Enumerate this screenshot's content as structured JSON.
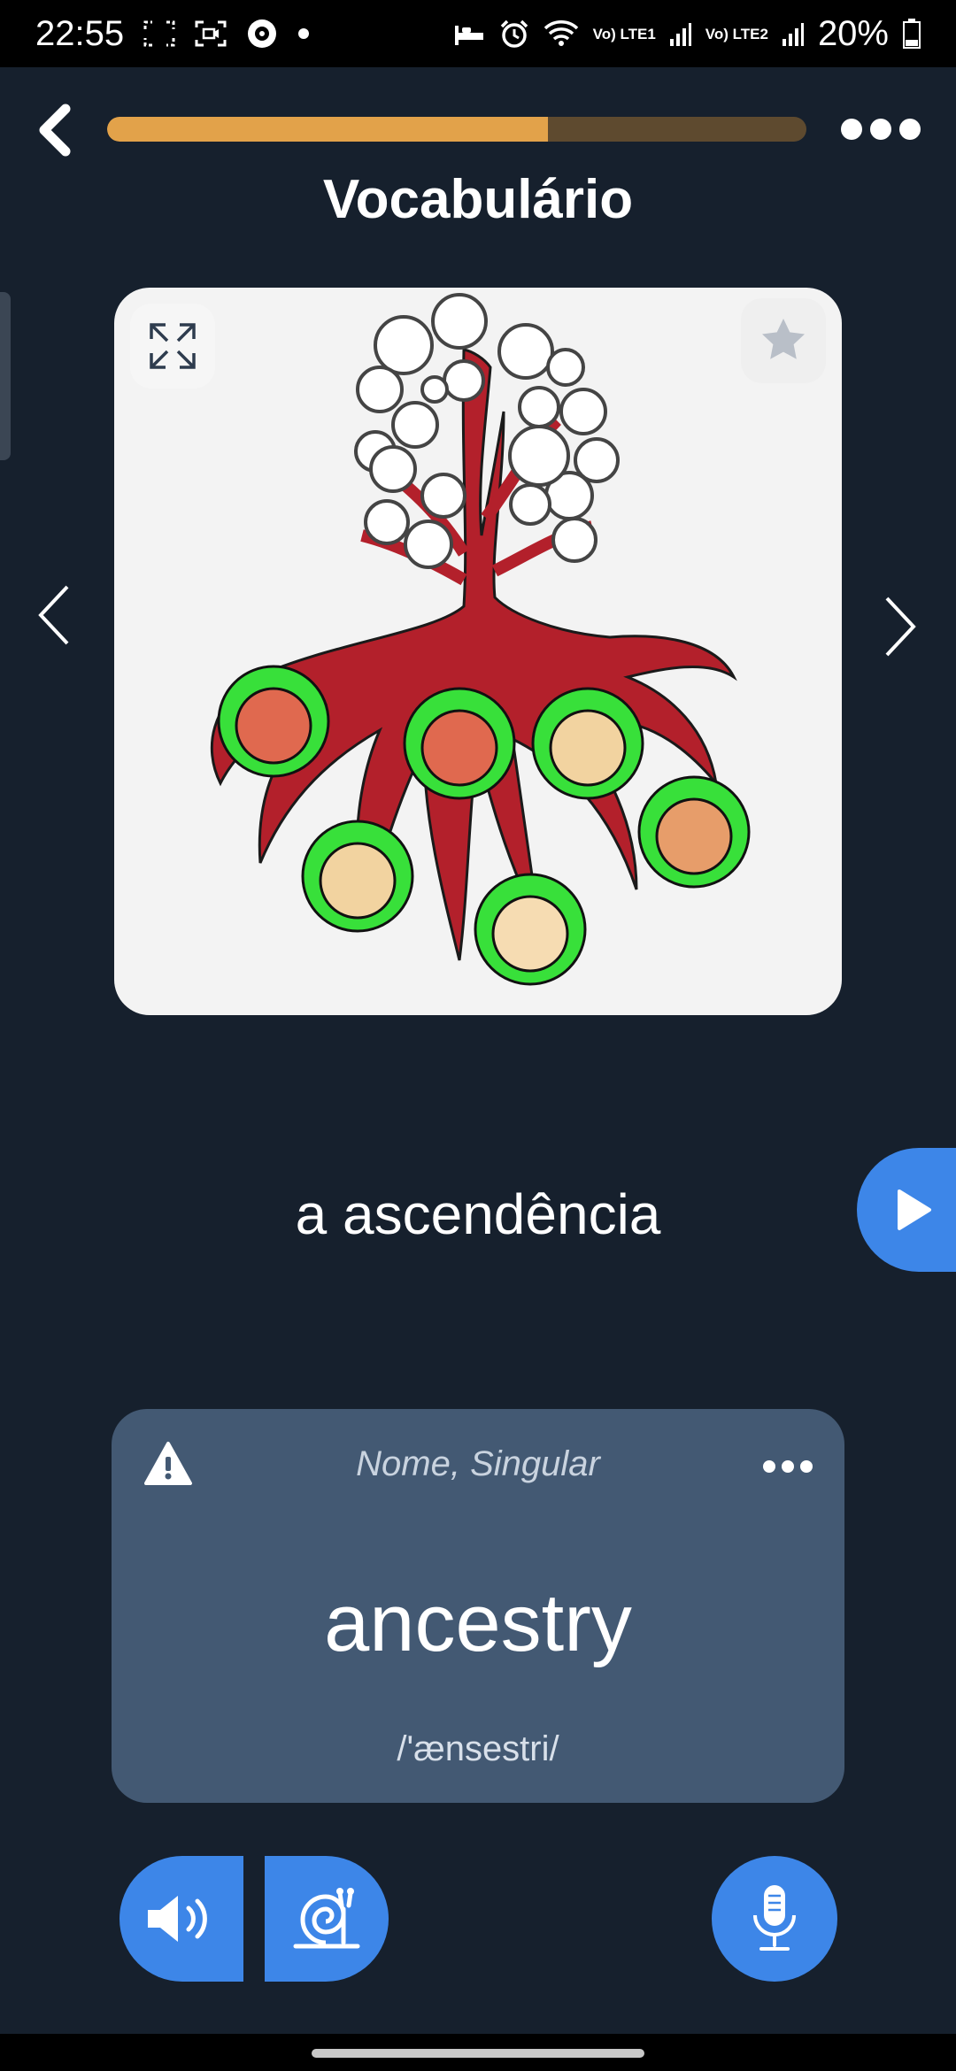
{
  "status_bar": {
    "time": "22:55",
    "sim1_label": "Vo) LTE1",
    "sim2_label": "Vo) LTE2",
    "battery": "20%",
    "icons": [
      "screenshot-icon",
      "screen-record-icon",
      "app-notification-icon",
      "dot-icon",
      "sleep-icon",
      "alarm-icon",
      "wifi-icon",
      "signal-icon",
      "battery-icon"
    ]
  },
  "header": {
    "title": "Vocabulário",
    "progress": 0.63,
    "colors": {
      "progress_fill": "#e2a24a",
      "progress_track": "#5e4a2f"
    }
  },
  "card": {
    "illustration": "family-tree-ancestry-illustration",
    "expand_icon": "expand-icon",
    "favorite_icon": "star-icon"
  },
  "word": {
    "portuguese": "a ascendência"
  },
  "translation_card": {
    "grammar": "Nome, Singular",
    "english": "ancestry",
    "phonetic": "/'ænsestri/"
  },
  "controls": {
    "audio": "speaker-icon",
    "slow_audio": "snail-icon",
    "microphone": "microphone-icon"
  },
  "theme": {
    "background": "#16202d",
    "accent": "#3d86e8",
    "card": "#435973"
  }
}
